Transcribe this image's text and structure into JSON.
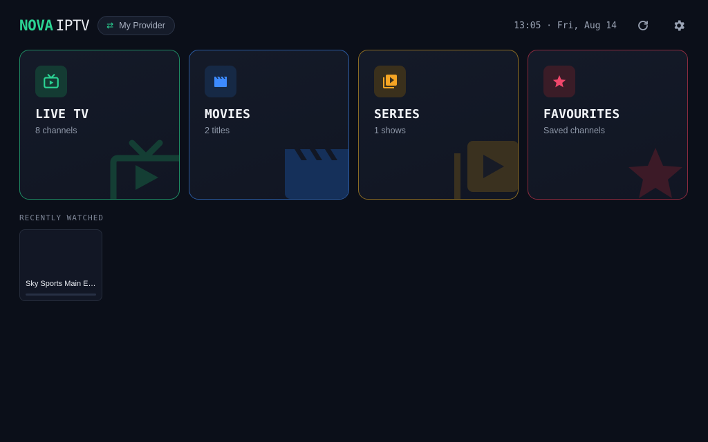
{
  "header": {
    "logo_accent": "NOVA",
    "logo_rest": "IPTV",
    "provider_label": "My Provider",
    "clock": "13:05 · Fri, Aug 14"
  },
  "cards": [
    {
      "id": "live",
      "title": "LIVE TV",
      "subtitle": "8 channels",
      "icon": "tv-icon",
      "color": "#2bd393"
    },
    {
      "id": "movies",
      "title": "MOVIES",
      "subtitle": "2 titles",
      "icon": "clapperboard-icon",
      "color": "#3d8bff"
    },
    {
      "id": "series",
      "title": "SERIES",
      "subtitle": "1 shows",
      "icon": "play-library-icon",
      "color": "#f5a524"
    },
    {
      "id": "fav",
      "title": "FAVOURITES",
      "subtitle": "Saved channels",
      "icon": "star-icon",
      "color": "#f0476b"
    }
  ],
  "recently_watched": {
    "label": "RECENTLY WATCHED",
    "items": [
      {
        "title": "Sky Sports Main Event",
        "progress": 0
      }
    ]
  }
}
